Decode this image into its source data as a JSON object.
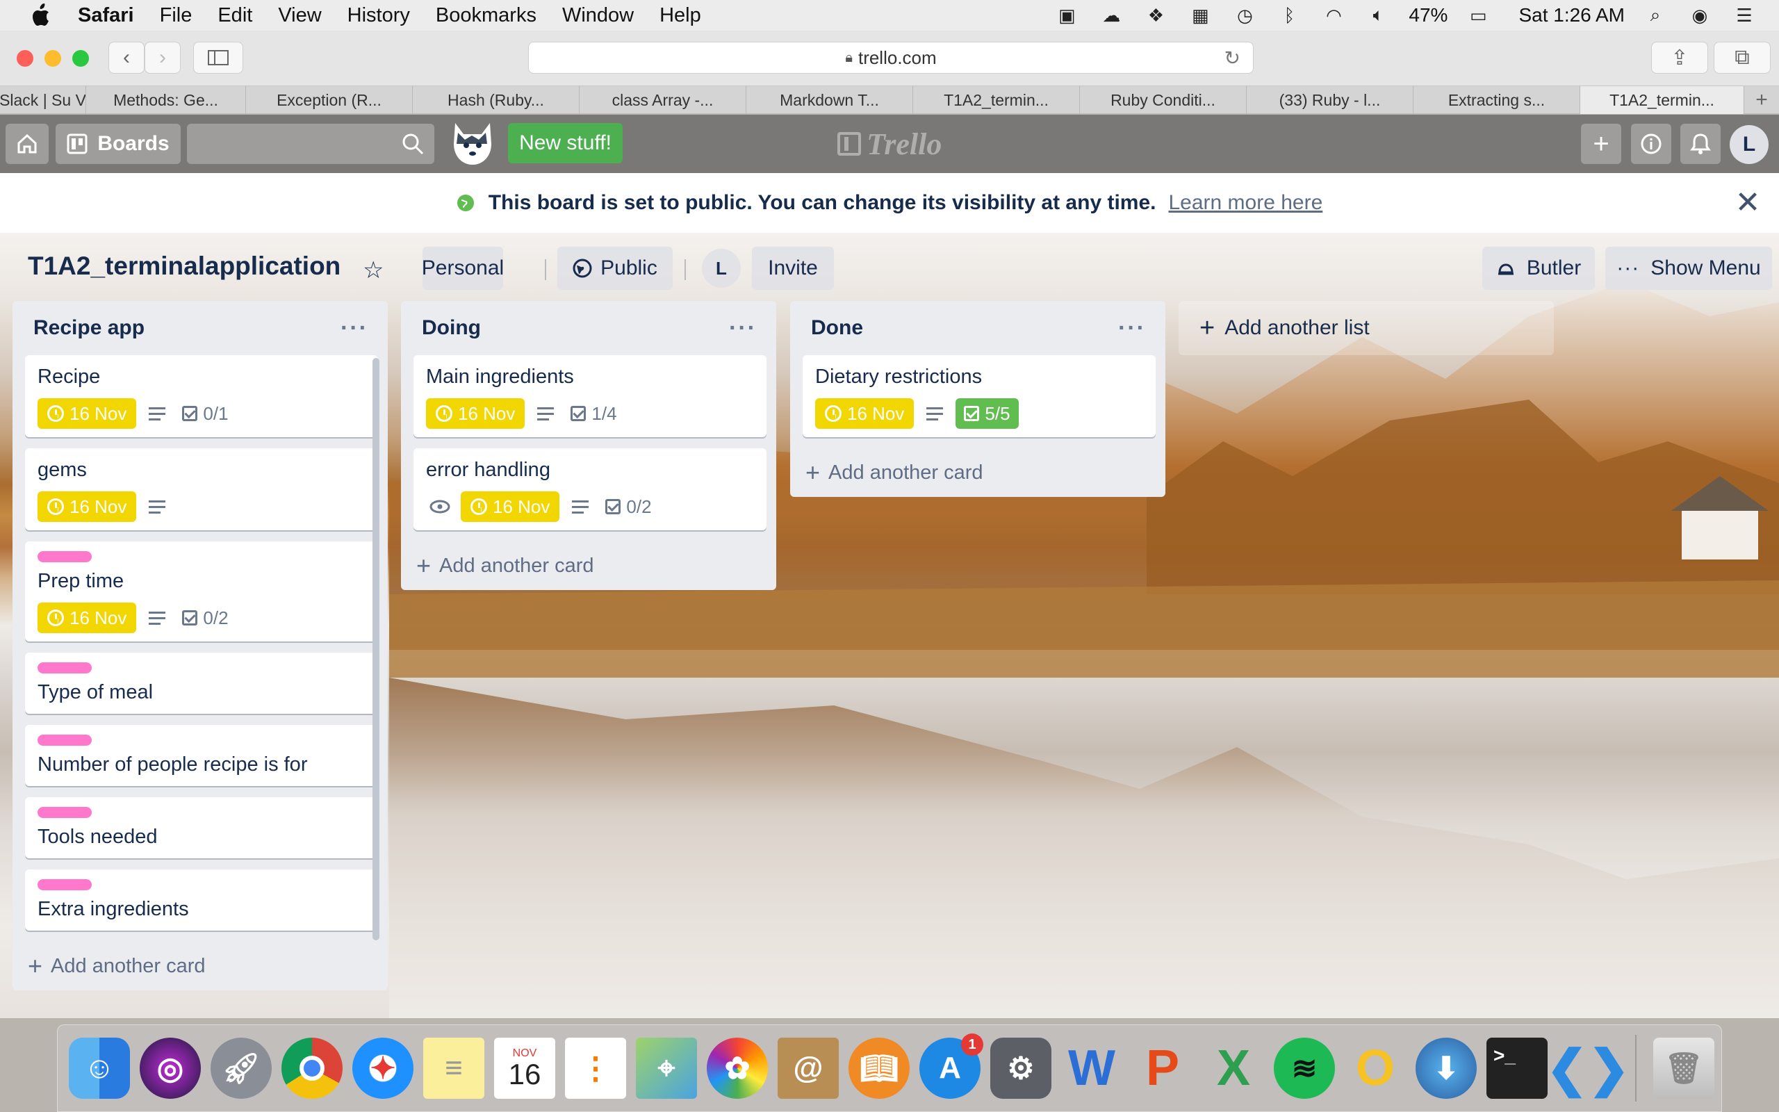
{
  "menubar": {
    "items": [
      "Safari",
      "File",
      "Edit",
      "View",
      "History",
      "Bookmarks",
      "Window",
      "Help"
    ],
    "battery": "47%",
    "clock": "Sat 1:26 AM"
  },
  "toolbar": {
    "url": "trello.com"
  },
  "tabs": [
    "Slack | Su V",
    "Methods: Ge...",
    "Exception (R...",
    "Hash (Ruby...",
    "class Array -...",
    "Markdown T...",
    "T1A2_termin...",
    "Ruby Conditi...",
    "(33) Ruby - l...",
    "Extracting s...",
    "T1A2_termin..."
  ],
  "header": {
    "boards": "Boards",
    "new_stuff": "New stuff!",
    "logo": "Trello",
    "avatar": "L"
  },
  "banner": {
    "message": "This board is set to public. You can change its visibility at any time.",
    "link": "Learn more here"
  },
  "board": {
    "title": "T1A2_terminalapplication",
    "team": "Personal",
    "visibility": "Public",
    "member": "L",
    "invite": "Invite",
    "butler": "Butler",
    "show_menu": "Show Menu",
    "add_list": "Add another list",
    "add_card": "Add another card"
  },
  "lists": [
    {
      "title": "Recipe app",
      "cards": [
        {
          "title": "Recipe",
          "due": "16 Nov",
          "desc": true,
          "checklist": "0/1"
        },
        {
          "title": "gems",
          "due": "16 Nov",
          "desc": true
        },
        {
          "title": "Prep time",
          "label": "pink",
          "due": "16 Nov",
          "desc": true,
          "checklist": "0/2"
        },
        {
          "title": "Type of meal",
          "label": "pink"
        },
        {
          "title": "Number of people recipe is for",
          "label": "pink"
        },
        {
          "title": "Tools needed",
          "label": "pink"
        },
        {
          "title": "Extra ingredients",
          "label": "pink"
        }
      ]
    },
    {
      "title": "Doing",
      "cards": [
        {
          "title": "Main ingredients",
          "due": "16 Nov",
          "desc": true,
          "checklist": "1/4"
        },
        {
          "title": "error handling",
          "watch": true,
          "due": "16 Nov",
          "desc": true,
          "checklist": "0/2"
        }
      ]
    },
    {
      "title": "Done",
      "cards": [
        {
          "title": "Dietary restrictions",
          "due": "16 Nov",
          "desc": true,
          "checklist": "5/5",
          "checklist_complete": true
        }
      ]
    }
  ],
  "dock": {
    "calendar_month": "NOV",
    "calendar_day": "16",
    "appstore_badge": "1",
    "apps": [
      "finder-icon",
      "siri-icon",
      "launchpad-icon",
      "chrome-icon",
      "safari-icon",
      "notes-icon",
      "calendar-icon",
      "reminders-icon",
      "maps-icon",
      "photos-icon",
      "contacts-icon",
      "books-icon",
      "app-store-icon",
      "system-preferences-icon",
      "word-icon",
      "powerpoint-icon",
      "excel-icon",
      "spotify-icon",
      "outlook-icon",
      "migration-icon",
      "terminal-icon",
      "vscode-icon",
      "trash-icon"
    ]
  },
  "colors": {
    "due": "#f2d600",
    "label_pink": "#ff78cb",
    "checklist_done": "#61bd4f",
    "new_stuff": "#4caf50"
  }
}
